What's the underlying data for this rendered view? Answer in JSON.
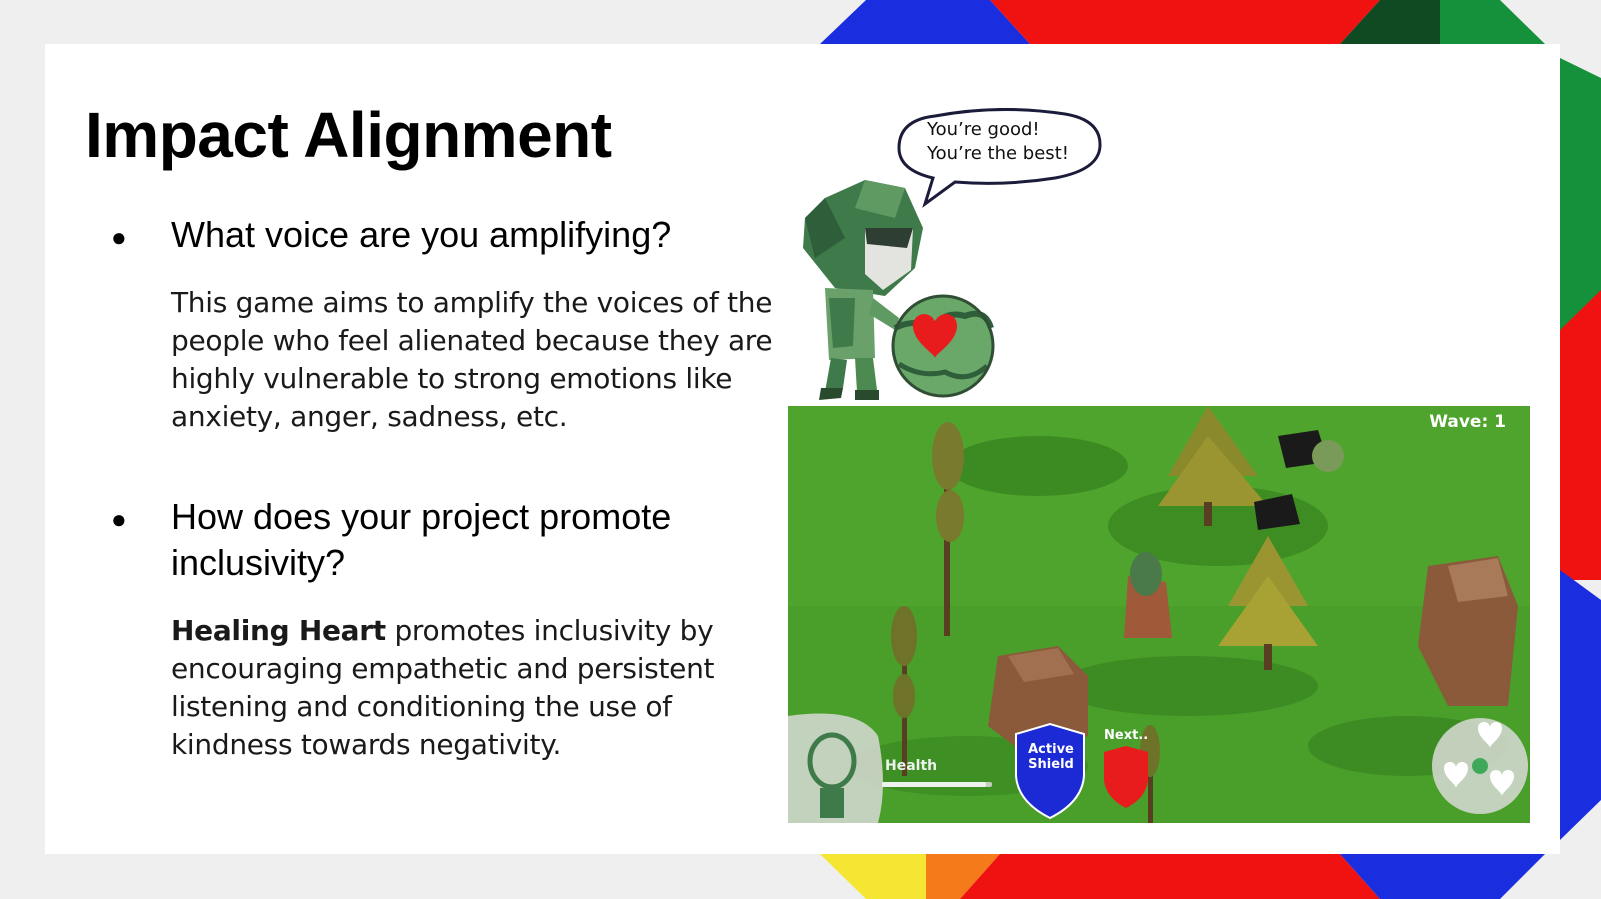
{
  "title": "Impact Alignment",
  "bullets": [
    {
      "question": "What voice are you amplifying?",
      "answer": "This game aims to amplify the voices of the people who feel alienated because they are highly vulnerable to strong emotions like anxiety, anger, sadness, etc."
    },
    {
      "question": "How does your project promote inclusivity?",
      "answer_bold": "Healing Heart",
      "answer": " promotes inclusivity by encouraging empathetic and persistent listening and conditioning the use of kindness towards negativity."
    }
  ],
  "bubble": {
    "line1": "You’re good!",
    "line2": "You’re the best!"
  },
  "game_hud": {
    "wave": "Wave: 1",
    "health_label": "Health",
    "active_shield_line1": "Active",
    "active_shield_line2": "Shield",
    "next_label": "Next..",
    "health_fill": 0.95
  },
  "colors": {
    "background": "#efefef",
    "slide": "#ffffff",
    "grass": "#4a9e2a",
    "shield_active": "#1c2ad6",
    "shield_next": "#e81c1c"
  }
}
